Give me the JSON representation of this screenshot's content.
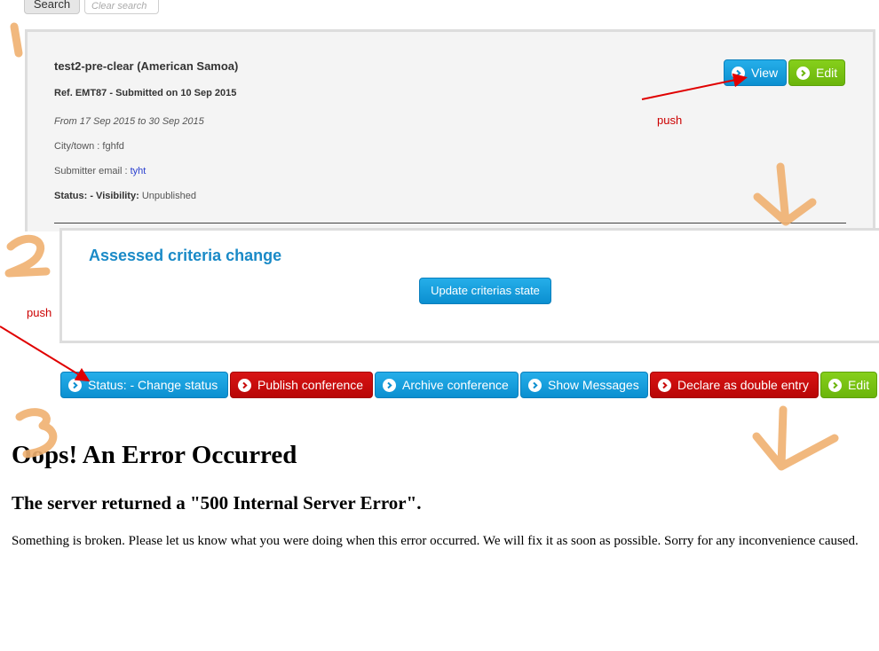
{
  "search": {
    "button_label": "Search",
    "clear_placeholder": "Clear search"
  },
  "conference": {
    "title": "test2-pre-clear (American Samoa)",
    "ref_line": "Ref. EMT87 - Submitted on 10 Sep 2015",
    "dates": "From 17 Sep 2015 to 30 Sep 2015",
    "city_line": "City/town : fghfd",
    "email_label": "Submitter email : ",
    "email_value": "tyht",
    "status_label": "Status: - Visibility:",
    "visibility_value": "Unpublished",
    "view_label": "View",
    "edit_label": "Edit"
  },
  "criteria": {
    "title": "Assessed criteria change",
    "update_label": "Update criterias state"
  },
  "actions": {
    "change_status": "Status: - Change status",
    "publish": "Publish conference",
    "archive": "Archive conference",
    "show_messages": "Show Messages",
    "declare_double": "Declare as double entry",
    "edit": "Edit"
  },
  "error": {
    "title": "Oops! An Error Occurred",
    "subtitle": "The server returned a \"500 Internal Server Error\".",
    "message": "Something is broken. Please let us know what you were doing when this error occurred. We will fix it as soon as possible. Sorry for any inconvenience caused."
  },
  "annotations": {
    "push_1": "push",
    "push_2": "push",
    "step_1": "1",
    "step_2": "2",
    "step_3": "3"
  },
  "colors": {
    "blue_button": "#1a9fde",
    "green_button": "#76c212",
    "red_button": "#c90b0b",
    "heading_blue": "#1a8ac7",
    "annotation_red": "#e00000",
    "annotation_orange": "#f0b070"
  }
}
